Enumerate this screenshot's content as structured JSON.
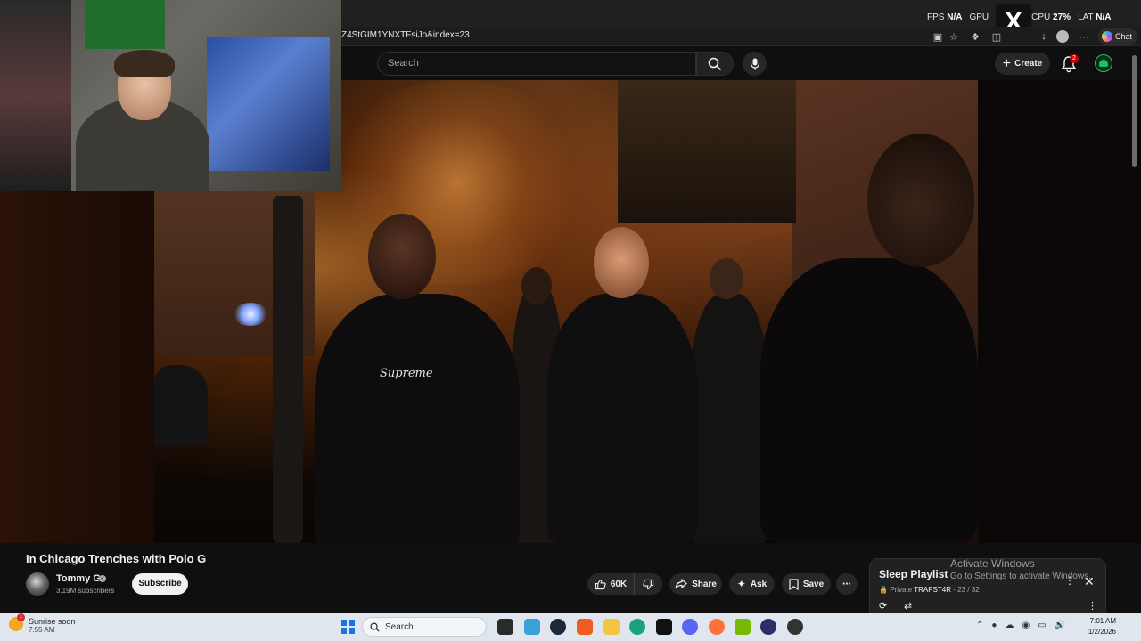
{
  "browser": {
    "url": "Z4StGIM1YNXTFsiJo&index=23",
    "chat_label": "Chat"
  },
  "overlay": {
    "fps_label": "FPS",
    "fps_value": "N/A",
    "gpu_label": "GPU",
    "gpu_value": "",
    "cpu_label": "CPU",
    "cpu_value": "27%",
    "lat_label": "LAT",
    "lat_value": "N/A"
  },
  "youtube": {
    "search_placeholder": "Search",
    "create_label": "Create",
    "notification_count": "2"
  },
  "video": {
    "title": "In Chicago Trenches with Polo G",
    "channel_name": "Tommy G",
    "subscribers": "3.19M subscribers",
    "subscribe_label": "Subscribe",
    "like_count": "60K",
    "share_label": "Share",
    "ask_label": "Ask",
    "save_label": "Save"
  },
  "playlist": {
    "title": "Sleep Playlist",
    "privacy": "Private",
    "owner": "TRAPST4R",
    "position": "23 / 32"
  },
  "watermark": {
    "line1": "Activate Windows",
    "line2": "Go to Settings to activate Windows."
  },
  "taskbar": {
    "weather_title": "Sunrise soon",
    "weather_time": "7:55 AM",
    "search_placeholder": "Search",
    "time": "7:01 AM",
    "date": "1/2/2026"
  },
  "colors": {
    "yt_background": "#0f0f0f",
    "brand_red": "#cc0000",
    "taskbar": "#dfe6ee"
  }
}
